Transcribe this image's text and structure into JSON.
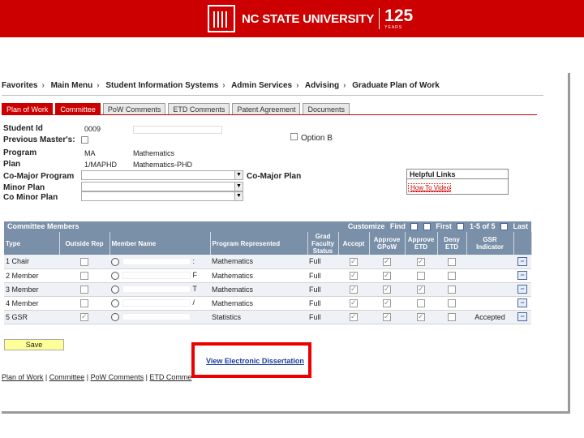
{
  "header": {
    "university": "NC STATE UNIVERSITY",
    "anniversary": "125",
    "anniversary_sub": "YEARS"
  },
  "menubar": {
    "items": [
      "Favorites",
      "Main Menu",
      "Student Information Systems",
      "Admin Services",
      "Advising",
      "Graduate Plan of Work"
    ]
  },
  "tabs": [
    "Plan of Work",
    "Committee",
    "PoW Comments",
    "ETD Comments",
    "Patent Agreement",
    "Documents"
  ],
  "form": {
    "student_id_label": "Student Id",
    "student_id_value": "0009",
    "previous_masters_label": "Previous Master's:",
    "option_b_label": "Option B",
    "program_label": "Program",
    "program_code": "MA",
    "program_name": "Mathematics",
    "plan_label": "Plan",
    "plan_code": "1/MAPHD",
    "plan_name": "Mathematics-PHD",
    "co_major_program_label": "Co-Major Program",
    "co_major_plan_label": "Co-Major Plan",
    "minor_plan_label": "Minor Plan",
    "co_minor_plan_label": "Co Minor Plan"
  },
  "helpful_links": {
    "title": "Helpful Links",
    "link": "How To Video"
  },
  "grid": {
    "title": "Committee Members",
    "nav": {
      "customize": "Customize",
      "find": "Find",
      "first": "First",
      "range": "1-5 of 5",
      "last": "Last"
    },
    "columns": [
      "Type",
      "Outside Rep",
      "Member Name",
      "Program Represented",
      "Grad Faculty Status",
      "Accept",
      "Approve GPoW",
      "Approve ETD",
      "Deny ETD",
      "GSR Indicator"
    ],
    "rows": [
      {
        "type": "1  Chair",
        "member_suffix": ":",
        "program": "Mathematics",
        "status": "Full",
        "accept": true,
        "approve_gpow": true,
        "approve_etd": true,
        "deny_etd": false,
        "outside": false,
        "gsr": ""
      },
      {
        "type": "2  Member",
        "member_suffix": "F",
        "program": "Mathematics",
        "status": "Full",
        "accept": true,
        "approve_gpow": true,
        "approve_etd": false,
        "deny_etd": false,
        "outside": false,
        "gsr": ""
      },
      {
        "type": "3  Member",
        "member_suffix": "T",
        "program": "Mathematics",
        "status": "Full",
        "accept": true,
        "approve_gpow": true,
        "approve_etd": true,
        "deny_etd": false,
        "outside": false,
        "gsr": ""
      },
      {
        "type": "4  Member",
        "member_suffix": "/",
        "program": "Mathematics",
        "status": "Full",
        "accept": true,
        "approve_gpow": true,
        "approve_etd": false,
        "deny_etd": false,
        "outside": false,
        "gsr": ""
      },
      {
        "type": "5  GSR",
        "member_suffix": "",
        "program": "Statistics",
        "status": "Full",
        "accept": true,
        "approve_gpow": true,
        "approve_etd": true,
        "deny_etd": false,
        "outside": true,
        "gsr": "Accepted"
      }
    ]
  },
  "save_label": "Save",
  "etd_link": "View Electronic Dissertation",
  "footer_links": [
    "Plan of Work",
    "Committee",
    "PoW Comments",
    "ETD Comme"
  ],
  "colors": {
    "brand_red": "#cc0000",
    "grid_header": "#7a8fa8",
    "highlight": "#ee0000"
  }
}
